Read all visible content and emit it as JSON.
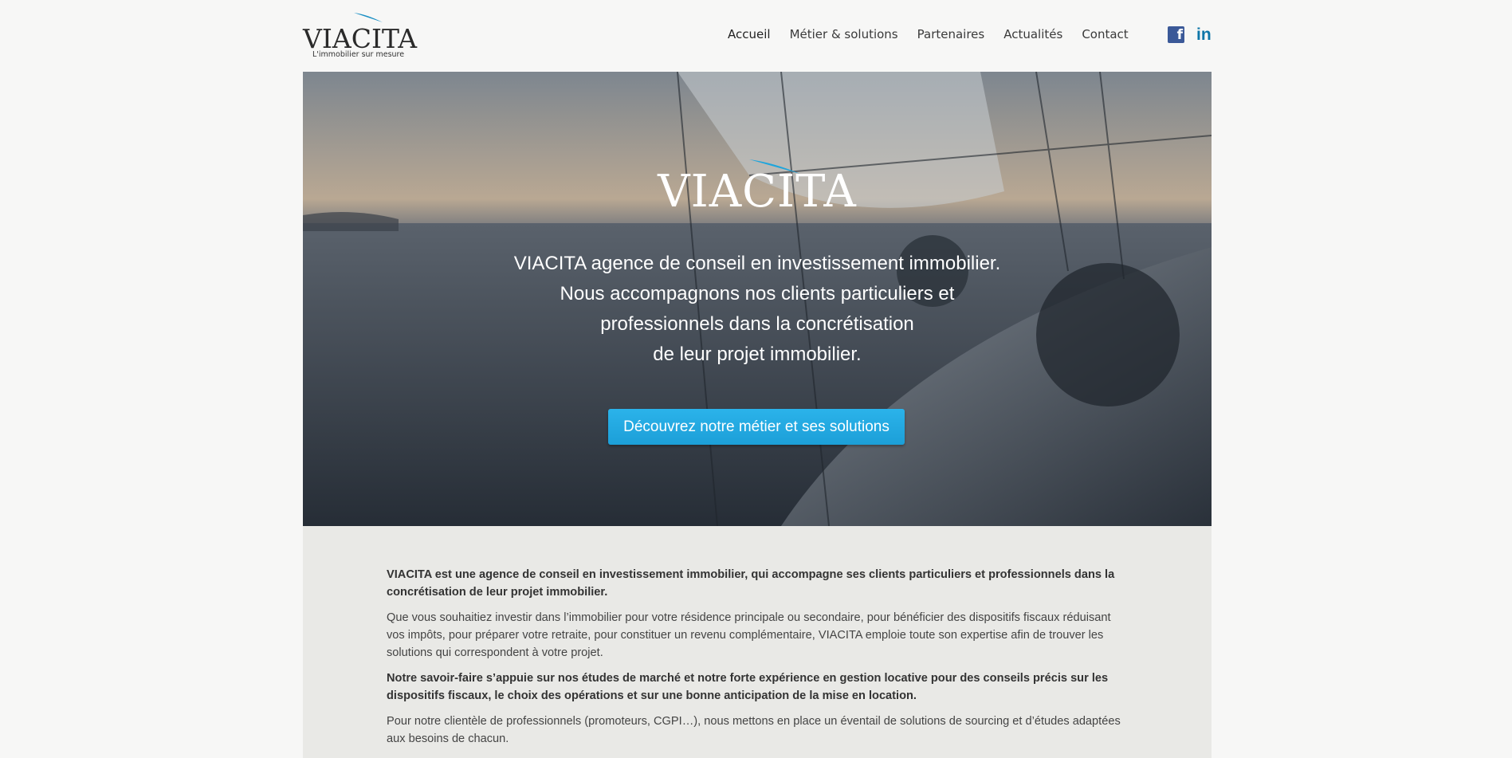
{
  "header": {
    "logo_text": "VIACITA",
    "logo_tagline": "L'immobilier sur mesure",
    "nav": [
      {
        "label": "Accueil",
        "active": true
      },
      {
        "label": "Métier & solutions"
      },
      {
        "label": "Partenaires"
      },
      {
        "label": "Actualités"
      },
      {
        "label": "Contact"
      }
    ],
    "social": {
      "facebook_glyph": "f",
      "linkedin_glyph": "in"
    }
  },
  "hero": {
    "logo_text": "VIACITA",
    "lines": [
      "VIACITA agence de conseil en investissement immobilier.",
      "Nous accompagnons nos clients particuliers et",
      "professionnels dans la concrétisation",
      "de leur projet immobilier."
    ],
    "cta_label": "Découvrez notre métier et ses solutions"
  },
  "content": {
    "paragraphs": [
      "VIACITA est une agence de conseil en investissement immobilier, qui accompagne ses clients particuliers et professionnels dans la concrétisation de leur projet immobilier.",
      "Que vous souhaitiez investir dans l’immobilier pour votre résidence principale ou secondaire, pour bénéficier des dispositifs fiscaux réduisant vos impôts, pour préparer votre retraite, pour constituer un revenu complémentaire, VIACITA emploie toute son expertise afin de trouver les solutions qui correspondent à votre projet.",
      "Notre savoir-faire s’appuie sur nos études de marché et notre forte expérience en gestion locative pour des conseils précis sur les dispositifs fiscaux, le choix des opérations et sur une bonne anticipation de la mise en location.",
      "Pour notre clientèle de professionnels (promoteurs, CGPI…), nous mettons en place un éventail de solutions de sourcing et d’études adaptées aux besoins de chacun."
    ]
  },
  "colors": {
    "accent": "#1ea5dc",
    "logo_swoosh": "#1a8fc4",
    "facebook": "#3b5998",
    "linkedin": "#0e76a8"
  },
  "icons": [
    "facebook-icon",
    "linkedin-icon",
    "logo-swoosh-icon"
  ]
}
